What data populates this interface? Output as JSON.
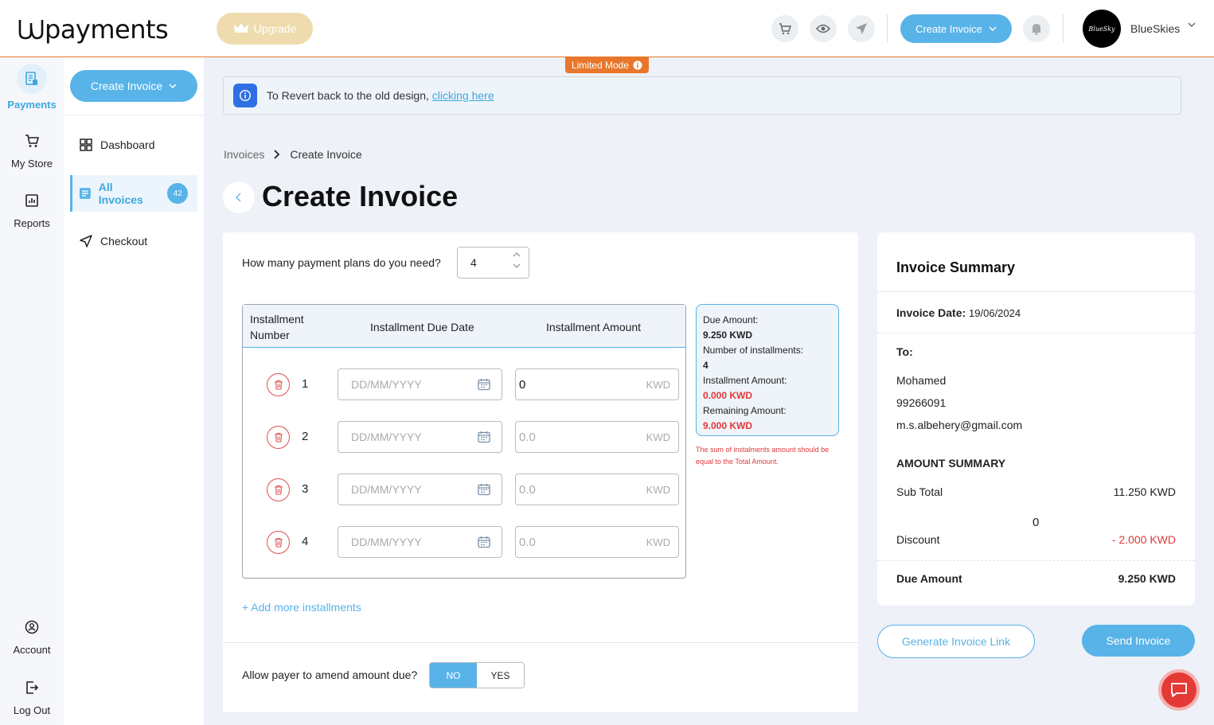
{
  "app": {
    "logo_text": "payments"
  },
  "topbar": {
    "upgrade_label": "Upgrade",
    "create_invoice_label": "Create Invoice",
    "user_name": "BlueSkies",
    "avatar_text": "BlueSky"
  },
  "limited_mode_label": "Limited Mode",
  "rail": {
    "items": [
      {
        "label": "Payments"
      },
      {
        "label": "My Store"
      },
      {
        "label": "Reports"
      },
      {
        "label": "Account"
      },
      {
        "label": "Log Out"
      }
    ]
  },
  "sidebar": {
    "create_label": "Create Invoice",
    "items": [
      {
        "label": "Dashboard"
      },
      {
        "label": "All Invoices",
        "badge": "42"
      },
      {
        "label": "Checkout"
      }
    ]
  },
  "banner": {
    "text": "To Revert back to the old design,",
    "link": "clicking here"
  },
  "breadcrumb": {
    "parent": "Invoices",
    "current": "Create Invoice"
  },
  "page_title": "Create Invoice",
  "plans": {
    "question": "How many payment plans do you need?",
    "value": "4"
  },
  "installments": {
    "headers": {
      "number": "Installment Number",
      "due_date": "Installment Due Date",
      "amount": "Installment Amount"
    },
    "date_placeholder": "DD/MM/YYYY",
    "currency": "KWD",
    "rows": [
      {
        "number": "1",
        "amount": "0"
      },
      {
        "number": "2",
        "amount": "0.0"
      },
      {
        "number": "3",
        "amount": "0.0"
      },
      {
        "number": "4",
        "amount": "0.0"
      }
    ],
    "add_more": "+ Add more installments"
  },
  "due_box": {
    "due_amount_label": "Due Amount:",
    "due_amount": "9.250 KWD",
    "count_label": "Number of installments:",
    "count": "4",
    "installment_label": "Installment Amount:",
    "installment_amount": "0.000 KWD",
    "remaining_label": "Remaining Amount:",
    "remaining_amount": "9.000 KWD",
    "note": "The sum of instalments amount should be equal to the Total Amount."
  },
  "amend": {
    "question": "Allow payer to amend amount due?",
    "no": "NO",
    "yes": "YES"
  },
  "summary": {
    "title": "Invoice Summary",
    "date_label": "Invoice Date:",
    "date": "19/06/2024",
    "to_label": "To:",
    "name": "Mohamed",
    "phone": "99266091",
    "email": "m.s.albehery@gmail.com",
    "amount_header": "AMOUNT SUMMARY",
    "subtotal_label": "Sub Total",
    "subtotal": "11.250 KWD",
    "zero_value": "0",
    "discount_label": "Discount",
    "discount": "- 2.000 KWD",
    "due_label": "Due Amount",
    "due": "9.250 KWD"
  },
  "actions": {
    "generate_link": "Generate Invoice Link",
    "send": "Send Invoice"
  },
  "colors": {
    "accent": "#58b3e8",
    "warning": "#e8772b",
    "error": "#e03838"
  }
}
